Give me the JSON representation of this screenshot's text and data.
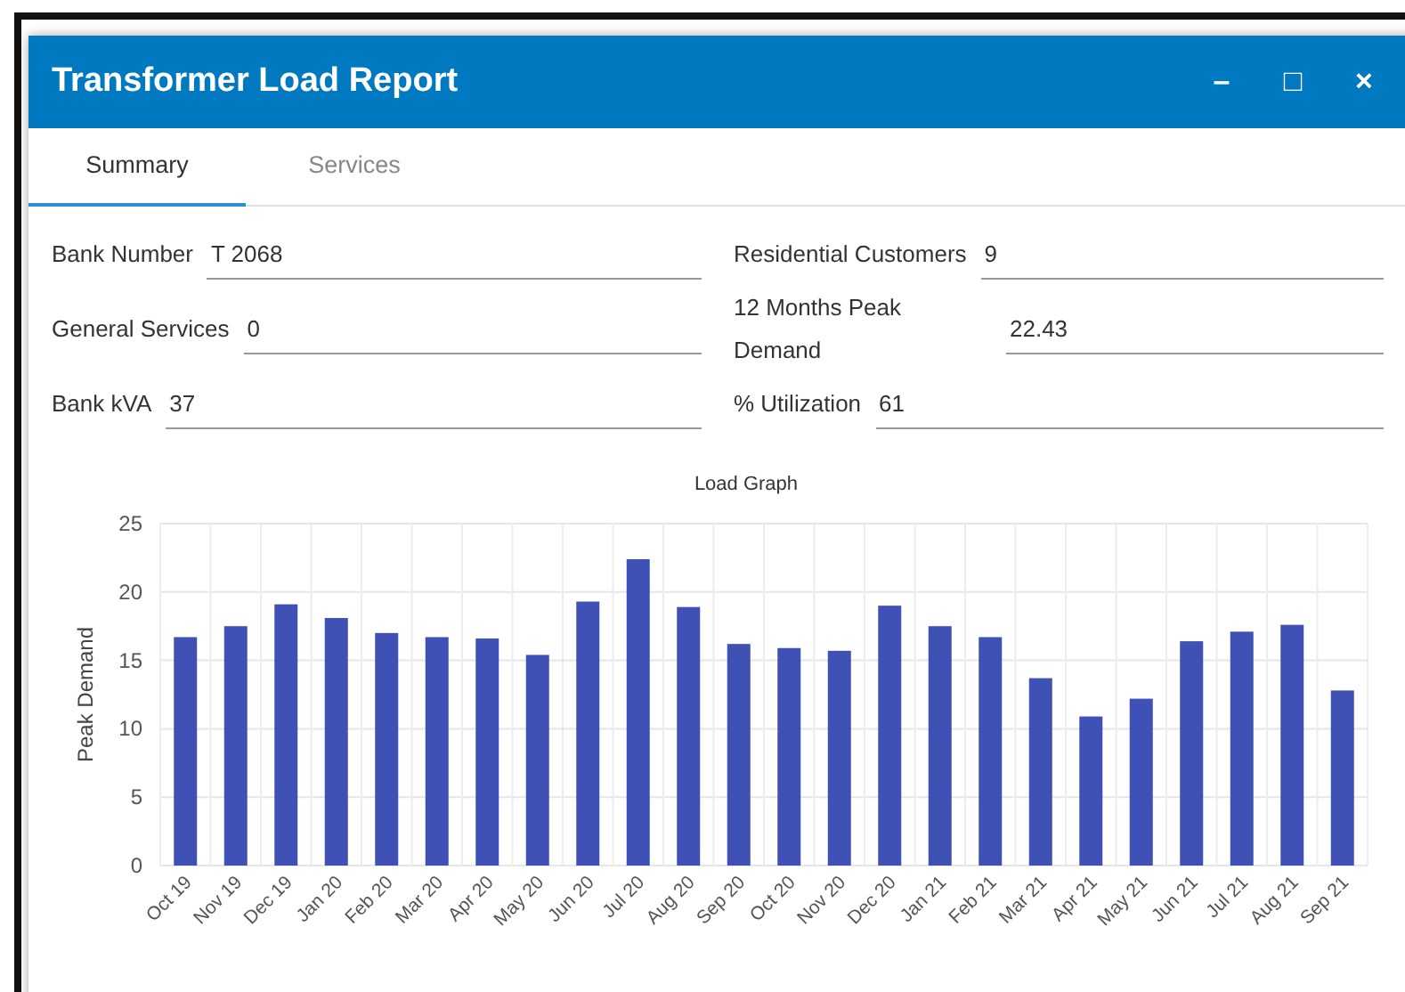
{
  "window": {
    "title": "Transformer Load Report",
    "controls": [
      "–",
      "□",
      "×"
    ]
  },
  "tabs": [
    {
      "label": "Summary",
      "selected": true
    },
    {
      "label": "Services",
      "selected": false
    }
  ],
  "fields_left": [
    {
      "label": "Bank Number",
      "value": "T 2068"
    },
    {
      "label": "General Services",
      "value": "0"
    },
    {
      "label": "Bank kVA",
      "value": "37"
    }
  ],
  "fields_right": [
    {
      "label": "Residential Customers",
      "value": "9"
    },
    {
      "label": "12 Months Peak Demand",
      "value": "22.43"
    },
    {
      "label": "% Utilization",
      "value": "61"
    }
  ],
  "chart_data": {
    "type": "bar",
    "grid": true,
    "title": "Load Graph",
    "ylabel": "Peak Demand",
    "ylim": [
      0,
      25
    ],
    "yticks": [
      0,
      5,
      10,
      15,
      20,
      25
    ],
    "categories": [
      "Oct 19",
      "Nov 19",
      "Dec 19",
      "Jan 20",
      "Feb 20",
      "Mar 20",
      "Apr 20",
      "May 20",
      "Jun 20",
      "Jul 20",
      "Aug 20",
      "Sep 20",
      "Oct 20",
      "Nov 20",
      "Dec 20",
      "Jan 21",
      "Feb 21",
      "Mar 21",
      "Apr 21",
      "May 21",
      "Jun 21",
      "Jul 21",
      "Aug 21",
      "Sep 21"
    ],
    "series": [
      {
        "color": "#3f51b5",
        "values": [
          16.7,
          17.5,
          19.1,
          18.1,
          17.0,
          16.7,
          16.6,
          15.4,
          19.3,
          22.4,
          18.9,
          16.2,
          15.9,
          15.7,
          19.0,
          17.5,
          16.7,
          13.7,
          10.9,
          12.2,
          16.4,
          17.1,
          17.6,
          12.8
        ]
      }
    ]
  }
}
